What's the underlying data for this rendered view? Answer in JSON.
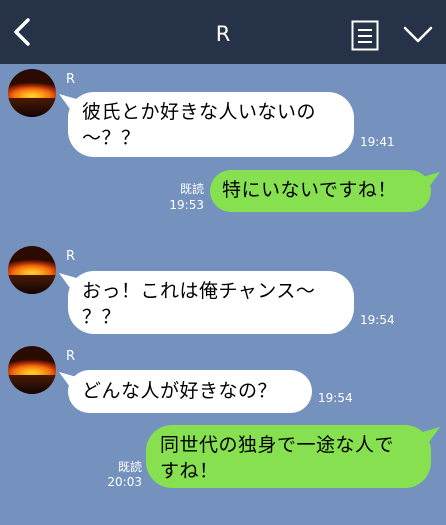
{
  "header": {
    "title": "R",
    "back_icon": "chevron-left-icon",
    "notes_icon": "note-list-icon",
    "menu_icon": "chevron-down-icon"
  },
  "colors": {
    "background": "#7492bd",
    "header": "#253247",
    "incoming_bubble": "#ffffff",
    "outgoing_bubble": "#86e050"
  },
  "messages": [
    {
      "direction": "incoming",
      "sender": "R",
      "lines": [
        "彼氏とか好きな人いないの",
        "〜？？"
      ],
      "time": "19:41"
    },
    {
      "direction": "outgoing",
      "lines": [
        "特にいないですね！"
      ],
      "read_label": "既読",
      "time": "19:53"
    },
    {
      "direction": "incoming",
      "sender": "R",
      "lines": [
        "おっ！これは俺チャンス〜",
        "？？"
      ],
      "time": "19:54"
    },
    {
      "direction": "incoming",
      "sender": "R",
      "lines": [
        "どんな人が好きなの？"
      ],
      "time": "19:54"
    },
    {
      "direction": "outgoing",
      "lines": [
        "同世代の独身で一途な人で",
        "すね！"
      ],
      "read_label": "既読",
      "time": "20:03"
    }
  ]
}
